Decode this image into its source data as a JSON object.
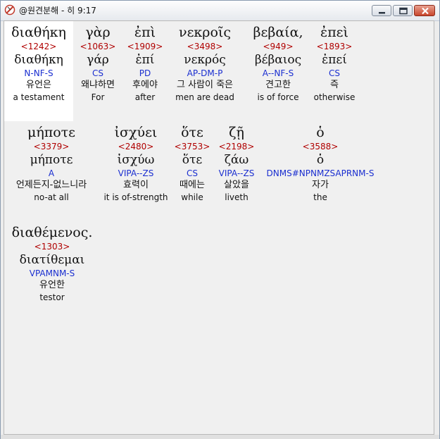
{
  "window": {
    "title": "@원견분해 - 히 9:17",
    "buttons": {
      "minimize": "minimize",
      "maximize": "maximize",
      "close": "close"
    }
  },
  "words": [
    {
      "greek": "διαθήκη",
      "strong": "<1242>",
      "lemma": "διαθήκη",
      "parsing": "N-NF-S",
      "korean": "유언은",
      "english": "a testament"
    },
    {
      "greek": "γὰρ",
      "strong": "<1063>",
      "lemma": "γάρ",
      "parsing": "CS",
      "korean": "왜냐하면",
      "english": "For"
    },
    {
      "greek": "ἐπὶ",
      "strong": "<1909>",
      "lemma": "ἐπί",
      "parsing": "PD",
      "korean": "후에야",
      "english": "after"
    },
    {
      "greek": "νεκροῖς",
      "strong": "<3498>",
      "lemma": "νεκρός",
      "parsing": "AP-DM-P",
      "korean": "그 사람이 죽은",
      "english": "men are dead"
    },
    {
      "greek": "βεβαία,",
      "strong": "<949>",
      "lemma": "βέβαιος",
      "parsing": "A--NF-S",
      "korean": "견고한",
      "english": "is of force"
    },
    {
      "greek": "ἐπεὶ",
      "strong": "<1893>",
      "lemma": "ἐπεί",
      "parsing": "CS",
      "korean": "즉",
      "english": "otherwise"
    },
    {
      "greek": "μήποτε",
      "strong": "<3379>",
      "lemma": "μήποτε",
      "parsing": "A",
      "korean": "언제든지-없느니라",
      "english": "no-at all"
    },
    {
      "greek": "ἰσχύει",
      "strong": "<2480>",
      "lemma": "ἰσχύω",
      "parsing": "VIPA--ZS",
      "korean": "효력이",
      "english": "it is of-strength"
    },
    {
      "greek": "ὅτε",
      "strong": "<3753>",
      "lemma": "ὅτε",
      "parsing": "CS",
      "korean": "때에는",
      "english": "while"
    },
    {
      "greek": "ζῇ",
      "strong": "<2198>",
      "lemma": "ζάω",
      "parsing": "VIPA--ZS",
      "korean": "살았을",
      "english": "liveth"
    },
    {
      "greek": "ὁ",
      "strong": "<3588>",
      "lemma": "ὁ",
      "parsing": "DNMS#NPNMZSAPRNM-S",
      "korean": "자가",
      "english": "the"
    },
    {
      "greek": "διαθέμενος.",
      "strong": "<1303>",
      "lemma": "διατίθεμαι",
      "parsing": "VPAMNM-S",
      "korean": "유언한",
      "english": "testor"
    }
  ]
}
